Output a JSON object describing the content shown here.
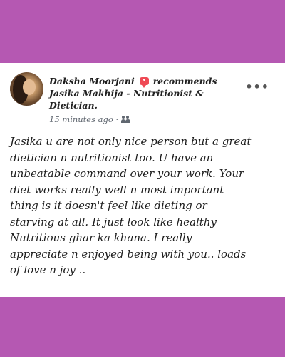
{
  "post": {
    "author": "Daksha Moorjani",
    "action": "recommends",
    "page": "Jasika Makhija - Nutritionist & Dietician.",
    "time": "15 minutes ago",
    "separator": "·",
    "icons": {
      "recommend": "recommend-icon",
      "audience": "friends-icon",
      "menu": "more-options-icon"
    },
    "more_label": "•••",
    "text": "Jasika u are not only nice person but a great\ndietician n nutritionist too.  U have an\nunbeatable command over your work. Your\ndiet works really well n most important\nthing is it doesn't feel like dieting or\nstarving at all. It just look like healthy\nNutritious ghar ka khana.  I really\nappreciate n enjoyed being with you.. loads\nof love n joy .."
  },
  "colors": {
    "background": "#b558b2",
    "card": "#ffffff",
    "recommend_icon": "#ef4a55"
  }
}
